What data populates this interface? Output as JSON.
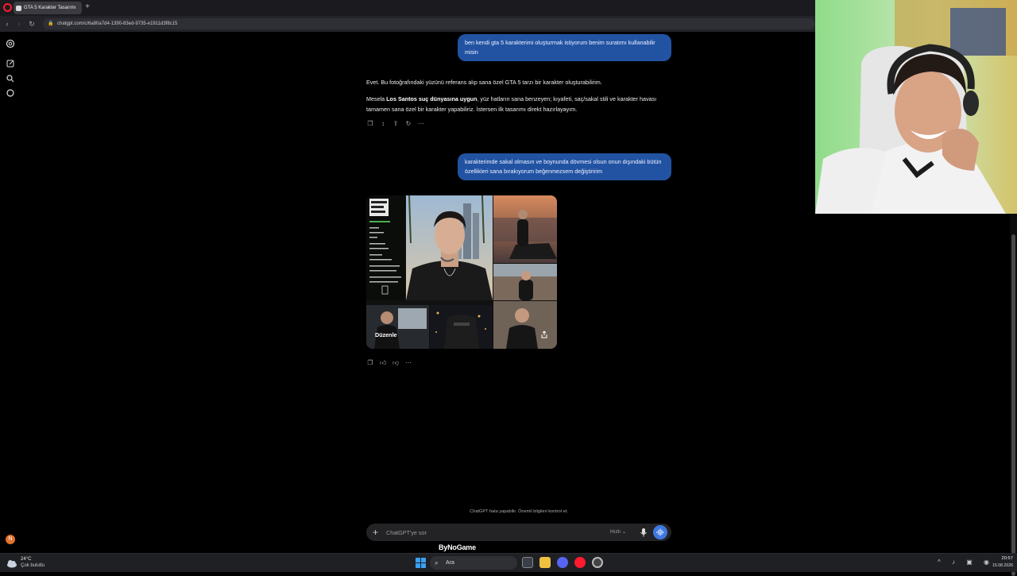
{
  "browser": {
    "tab_title": "GTA 5 Karakter Tasarımı",
    "new_tab_symbol": "+",
    "url": "chatgpt.com/c/6a80a7d4-1390-83ed-9735-e1911d3f8c15"
  },
  "chat": {
    "messages": [
      {
        "role": "user",
        "text": "ben kendi  gta 5 karakterimi oluşturmak istiyorum benim suratımı kullanabilir misin"
      },
      {
        "role": "assistant",
        "p1": "Evet. Bu fotoğrafındaki yüzünü referans alıp sana özel GTA 5 tarzı bir karakter oluşturabilirim.",
        "p2_prefix": "Mesela ",
        "p2_bold": "Los Santos suç dünyasına uygun",
        "p2_rest": ", yüz hatların sana benzeyen; kıyafeti, saç/sakal stili ve karakter havası tamamen sana özel bir karakter yapabiliriz. İstersen ilk tasarımı direkt hazırlayayım."
      },
      {
        "role": "user",
        "text": "karakterimde sakal olmasın  ve boynunda dövmesi olsun onun dışındaki bütün özellikleri sana bırakıyorum beğenmezsem değiştiririm"
      }
    ],
    "image_card": {
      "edit_label": "Düzenle"
    }
  },
  "composer": {
    "disclaimer": "ChatGPT hata yapabilir. Önemli bilgileri kontrol et.",
    "placeholder": "ChatGPT'ye sor",
    "model_label": "Hızlı ⌄"
  },
  "overlay": {
    "watermark": "ByNoGame",
    "badge_letter": "N"
  },
  "taskbar": {
    "weather_temp": "24°C",
    "weather_desc": "Çok bulutlu",
    "search_label": "Ara",
    "time": "20:57",
    "date": "15.08.2026"
  },
  "colors": {
    "user_bubble": "#2253a3",
    "voice_button": "#3f78e0",
    "browser_accent": "#ff1b2d"
  }
}
